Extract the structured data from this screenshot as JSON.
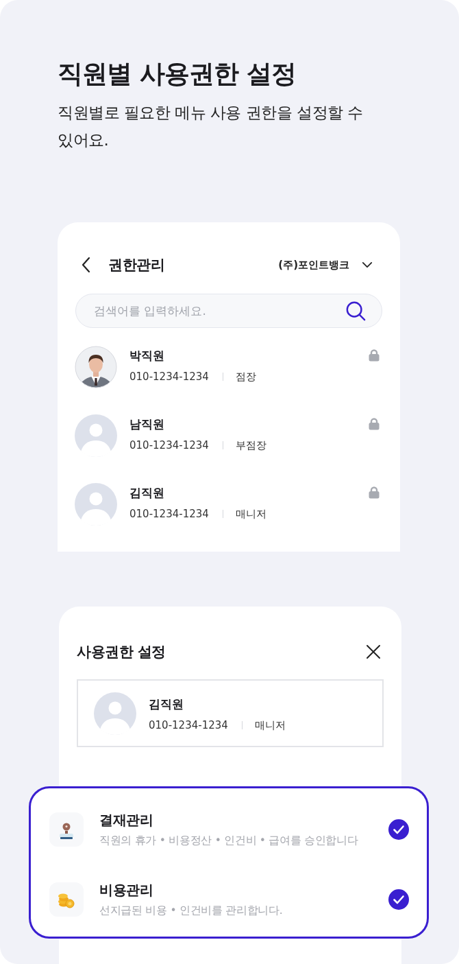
{
  "header": {
    "title": "직원별 사용권한 설정",
    "subtitle": "직원별로 필요한 메뉴 사용 권한을 설정할 수 있어요."
  },
  "list_screen": {
    "title": "권한관리",
    "company": "(주)포인트뱅크",
    "search": {
      "placeholder": "검색어를 입력하세요."
    },
    "employees": [
      {
        "name": "박직원",
        "phone": "010-1234-1234",
        "position": "점장",
        "photo": true,
        "locked": true
      },
      {
        "name": "남직원",
        "phone": "010-1234-1234",
        "position": "부점장",
        "photo": false,
        "locked": true
      },
      {
        "name": "김직원",
        "phone": "010-1234-1234",
        "position": "매니저",
        "photo": false,
        "locked": true
      }
    ]
  },
  "settings_sheet": {
    "title": "사용권한 설정",
    "employee": {
      "name": "김직원",
      "phone": "010-1234-1234",
      "position": "매니저",
      "photo": false
    },
    "permissions": [
      {
        "title": "결재관리",
        "description": "직원의 휴가 • 비용정산 • 인건비 • 급여를 승인합니다",
        "checked": true
      },
      {
        "title": "비용관리",
        "description": "선지급된 비용 • 인건비를 관리합니다.",
        "checked": true
      }
    ]
  }
}
